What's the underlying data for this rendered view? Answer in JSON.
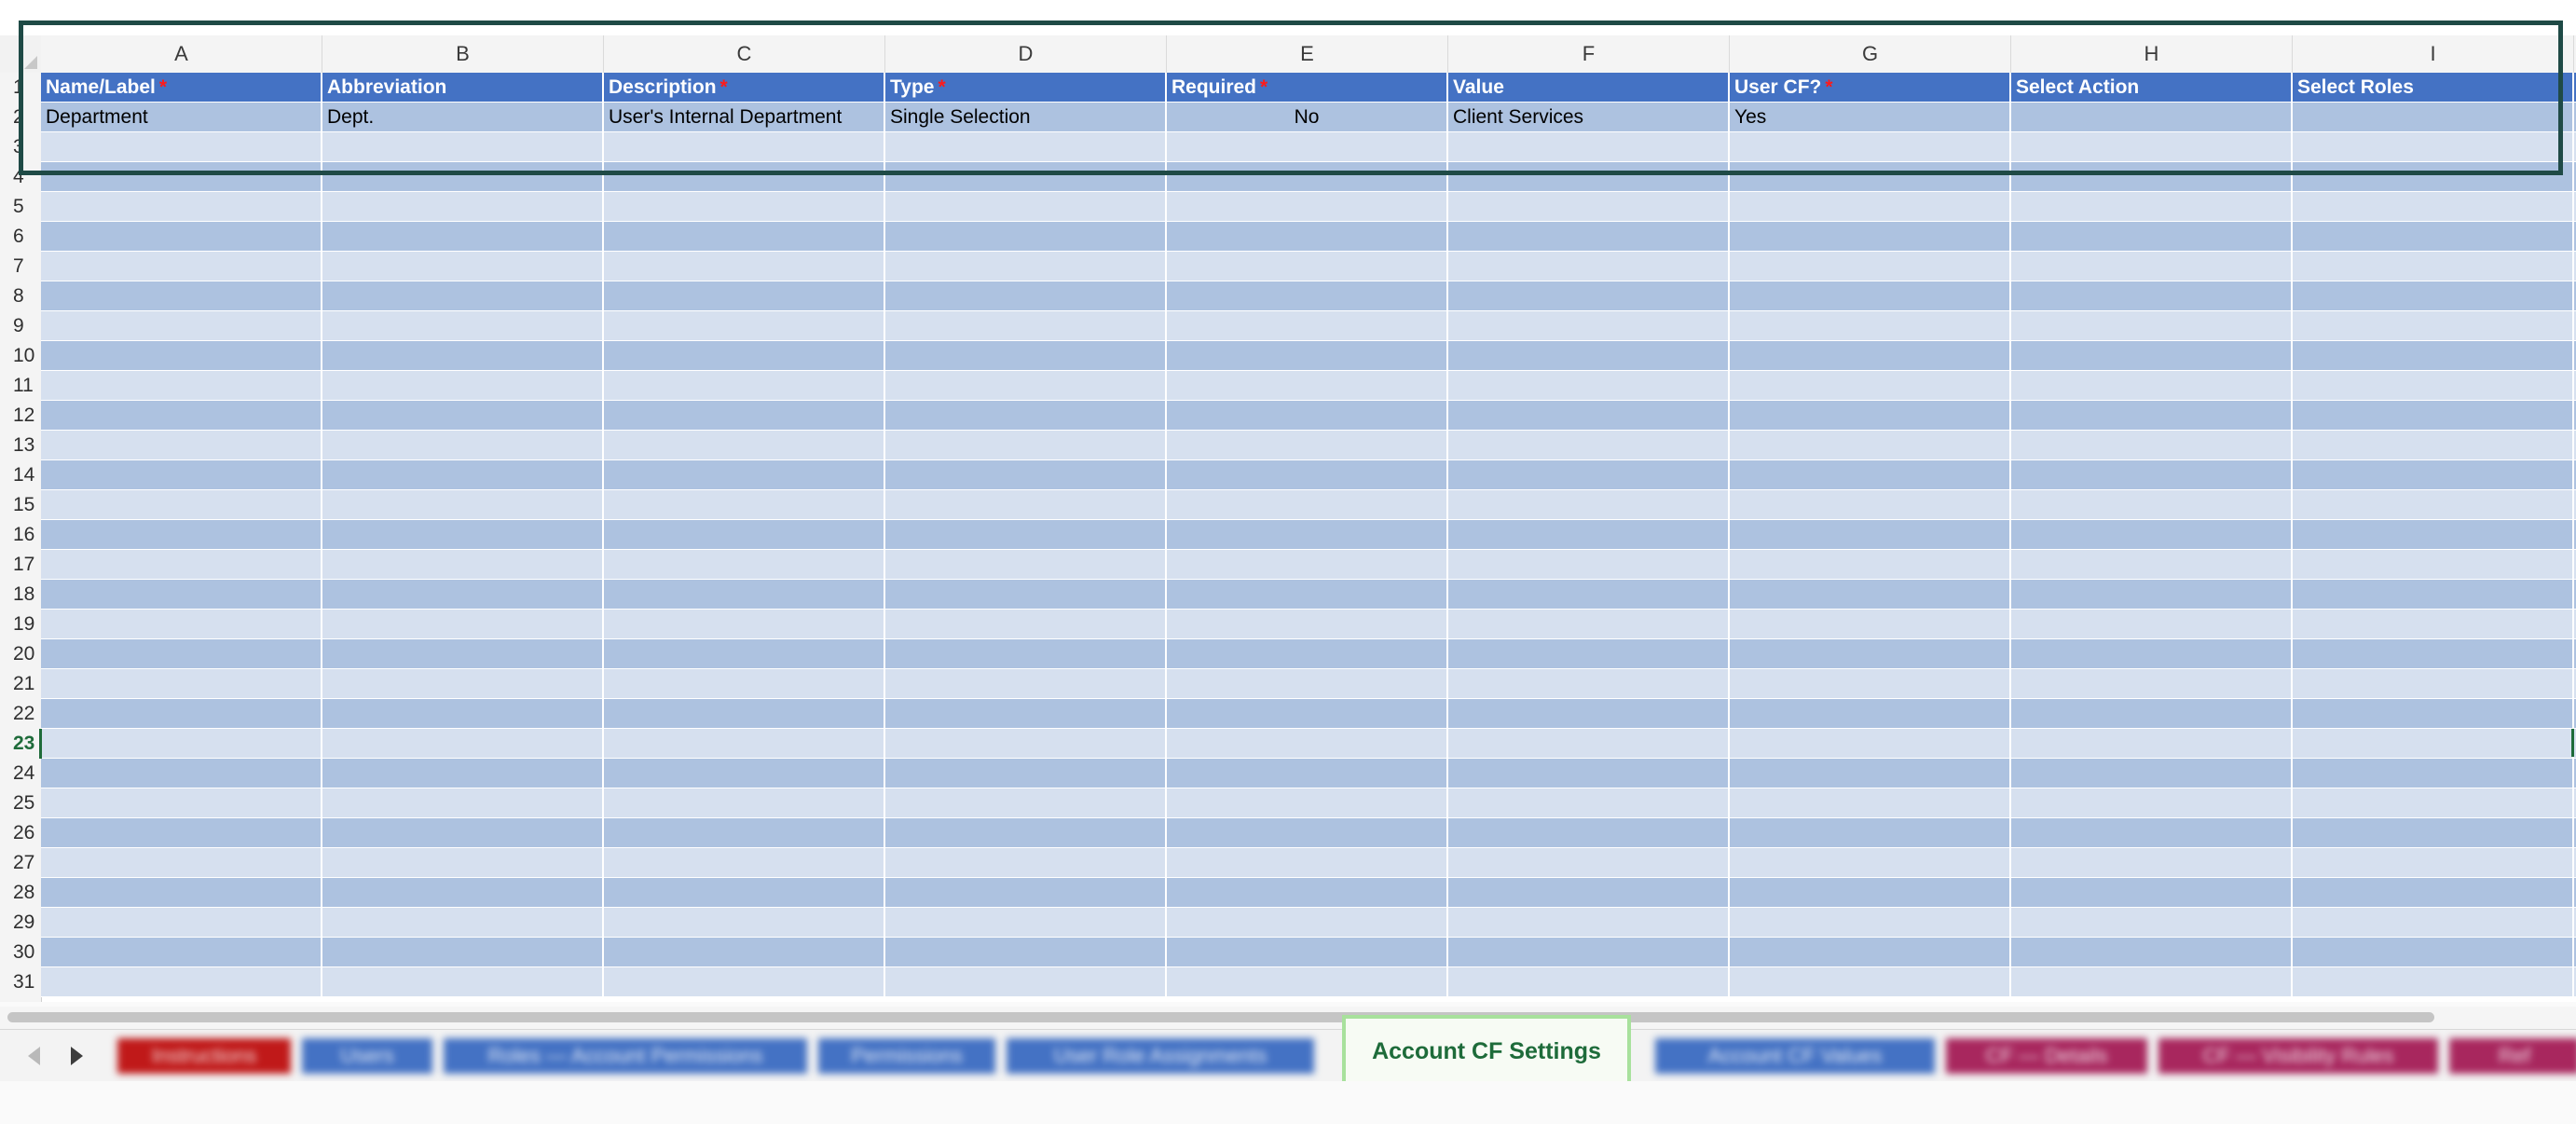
{
  "columns": [
    {
      "letter": "A",
      "label": "Name/Label",
      "required": true
    },
    {
      "letter": "B",
      "label": "Abbreviation",
      "required": false
    },
    {
      "letter": "C",
      "label": "Description",
      "required": true
    },
    {
      "letter": "D",
      "label": "Type",
      "required": true
    },
    {
      "letter": "E",
      "label": "Required",
      "required": true
    },
    {
      "letter": "F",
      "label": "Value",
      "required": false
    },
    {
      "letter": "G",
      "label": "User CF?",
      "required": true
    },
    {
      "letter": "H",
      "label": "Select Action",
      "required": false
    },
    {
      "letter": "I",
      "label": "Select Roles",
      "required": false
    }
  ],
  "required_marker": "*",
  "data_rows": [
    [
      "Department",
      "Dept.",
      "User's Internal Department",
      "Single Selection",
      "No",
      "Client Services",
      "Yes",
      "",
      ""
    ]
  ],
  "row_numbers": [
    "1",
    "2",
    "3",
    "4",
    "5",
    "6",
    "7",
    "8",
    "9",
    "10",
    "11",
    "12",
    "13",
    "14",
    "15",
    "16",
    "17",
    "18",
    "19",
    "20",
    "21",
    "22",
    "23",
    "24",
    "25",
    "26",
    "27",
    "28",
    "29",
    "30",
    "31"
  ],
  "active_row": "23",
  "sheet_tabs": [
    {
      "label": "Instructions",
      "color": "#c01919",
      "active": false
    },
    {
      "label": "Users",
      "color": "#4472c4",
      "active": false
    },
    {
      "label": "Roles — Account Permissions",
      "color": "#4472c4",
      "active": false
    },
    {
      "label": "Permissions",
      "color": "#4472c4",
      "active": false
    },
    {
      "label": "User Role Assignments",
      "color": "#4472c4",
      "active": false
    },
    {
      "label": "Account CF Settings",
      "color": "#4472c4",
      "active": true
    },
    {
      "label": "Account CF Values",
      "color": "#4472c4",
      "active": false
    },
    {
      "label": "CF — Details",
      "color": "#a8275e",
      "active": false
    },
    {
      "label": "CF — Visibility Rules",
      "color": "#a8275e",
      "active": false
    },
    {
      "label": "Ref",
      "color": "#a8275e",
      "active": false
    }
  ],
  "colors": {
    "header_fill": "#4472c4",
    "band_dark": "#adc2e0",
    "band_light": "#d6e0ef",
    "required_star": "#ff1a1a",
    "active_tab_text": "#1e6b3a",
    "active_tab_border": "#a8e19c",
    "selection_box": "#1f4a46"
  },
  "icons": [
    "scroll-left-icon",
    "scroll-right-icon"
  ]
}
